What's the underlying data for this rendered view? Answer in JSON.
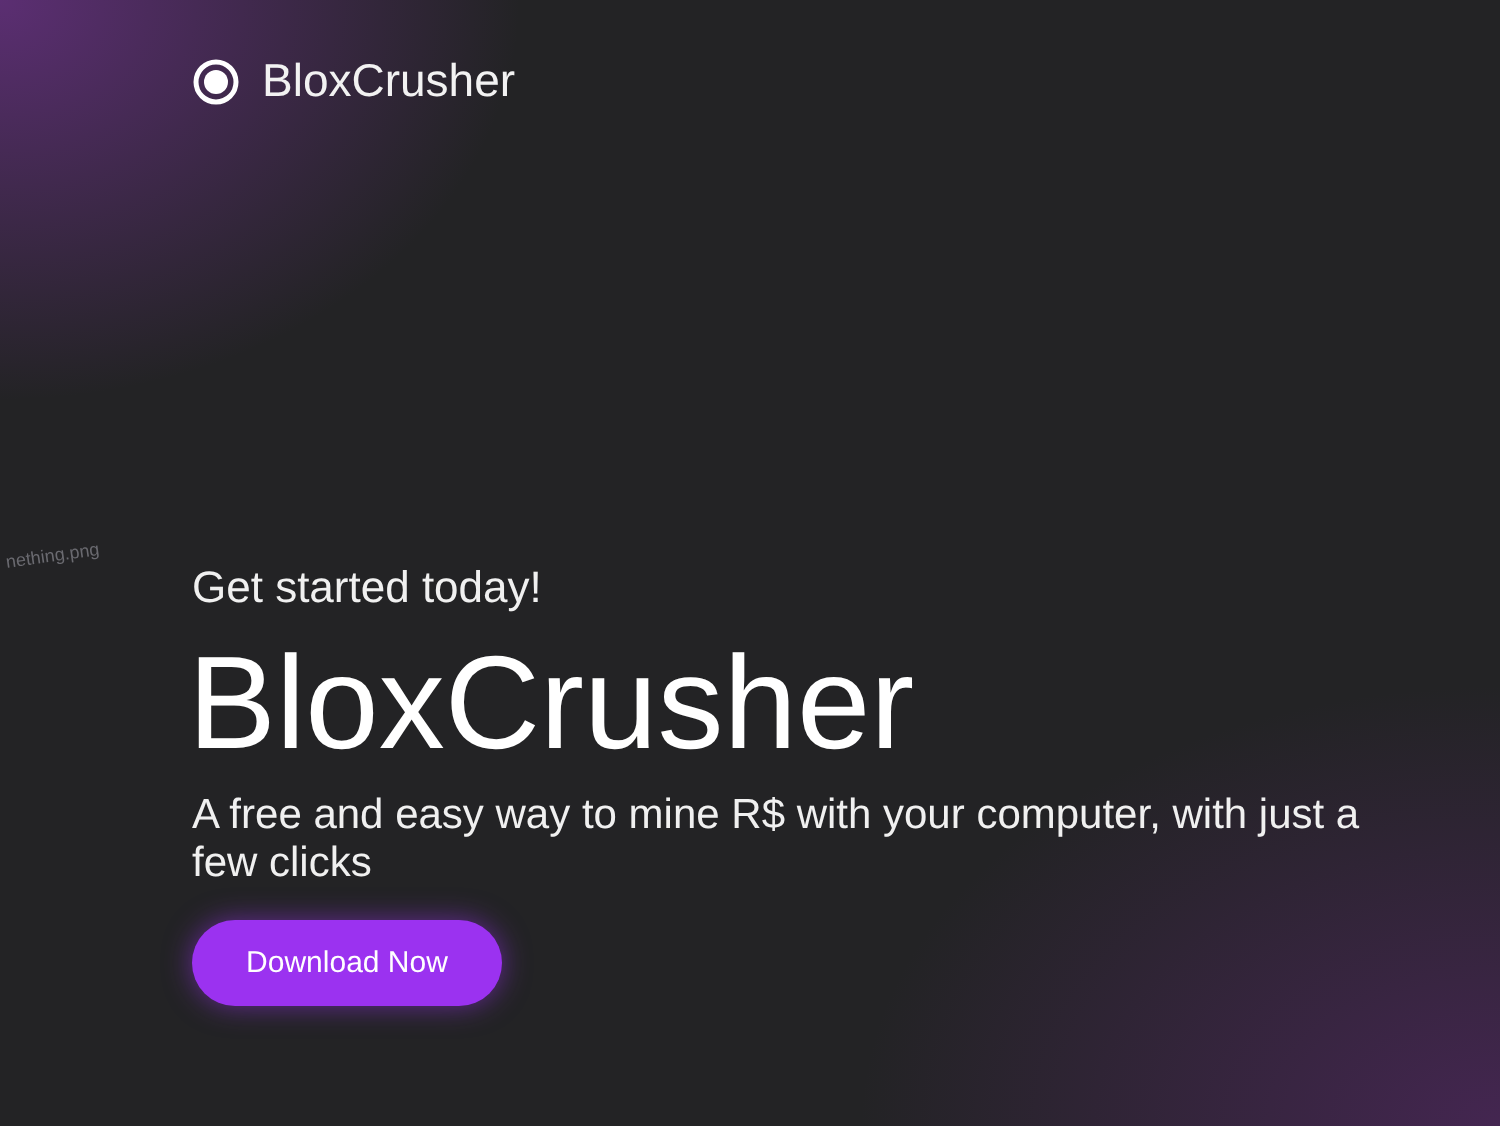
{
  "brand": {
    "name": "BloxCrusher"
  },
  "broken_image": {
    "alt": "nething.png"
  },
  "hero": {
    "kicker": "Get started today!",
    "title": "BloxCrusher",
    "subtitle": "A free and easy way to mine R$ with your computer, with just a few clicks",
    "button": "Download Now"
  }
}
